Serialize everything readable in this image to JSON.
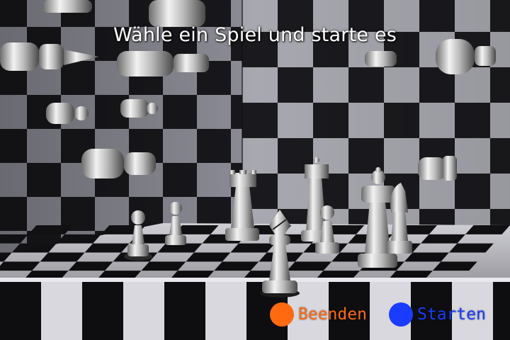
{
  "screen": {
    "title": "Wähle ein Spiel und starte es"
  },
  "buttons": {
    "quit": {
      "label": "Beenden",
      "color": "#ff6a10"
    },
    "start": {
      "label": "Starten",
      "color": "#1a3cff"
    }
  },
  "scene": {
    "background": "3d-chess-room",
    "board": "checkered-black-white",
    "pieces": [
      "pawn",
      "pawn",
      "rook",
      "bishop",
      "rook",
      "pawn",
      "queen",
      "knight"
    ]
  }
}
